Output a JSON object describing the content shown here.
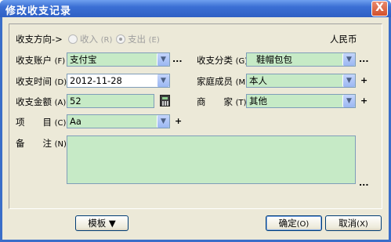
{
  "window": {
    "title": "修改收支记录",
    "close_label": "X"
  },
  "direction": {
    "label": "收支方向->",
    "options": [
      {
        "label": "收入",
        "hotkey": "(R)",
        "selected": false
      },
      {
        "label": "支出",
        "hotkey": "(E)",
        "selected": true
      }
    ],
    "currency": "人民币"
  },
  "account": {
    "label": "收支账户",
    "hotkey": "(F)",
    "value": "支付宝",
    "more": "..."
  },
  "category": {
    "label": "收支分类",
    "hotkey": "(G)",
    "value": "鞋帽包包",
    "more": "..."
  },
  "date": {
    "label": "收支时间",
    "hotkey": "(D)",
    "value": "2012-11-28"
  },
  "member": {
    "label": "家庭成员",
    "hotkey": "(M)",
    "value": "本人",
    "add": "+"
  },
  "amount": {
    "label": "收支金额",
    "hotkey": "(A)",
    "value": "52"
  },
  "merchant": {
    "label": "商　　家",
    "hotkey": "(T)",
    "value": "其他",
    "add": "+"
  },
  "project": {
    "label": "项　　目",
    "hotkey": "(C)",
    "value": "Aa",
    "add": "+"
  },
  "note": {
    "label": "备　　注",
    "hotkey": "(N)",
    "value": "",
    "more": "..."
  },
  "buttons": {
    "template": "模板 ▼",
    "ok": "确定",
    "ok_hotkey": "(O)",
    "cancel": "取消",
    "cancel_hotkey": "(X)"
  },
  "colors": {
    "field_bg": "#c6eac6",
    "titlebar": "#3b6fd4",
    "dialog_bg": "#ece9d8"
  }
}
